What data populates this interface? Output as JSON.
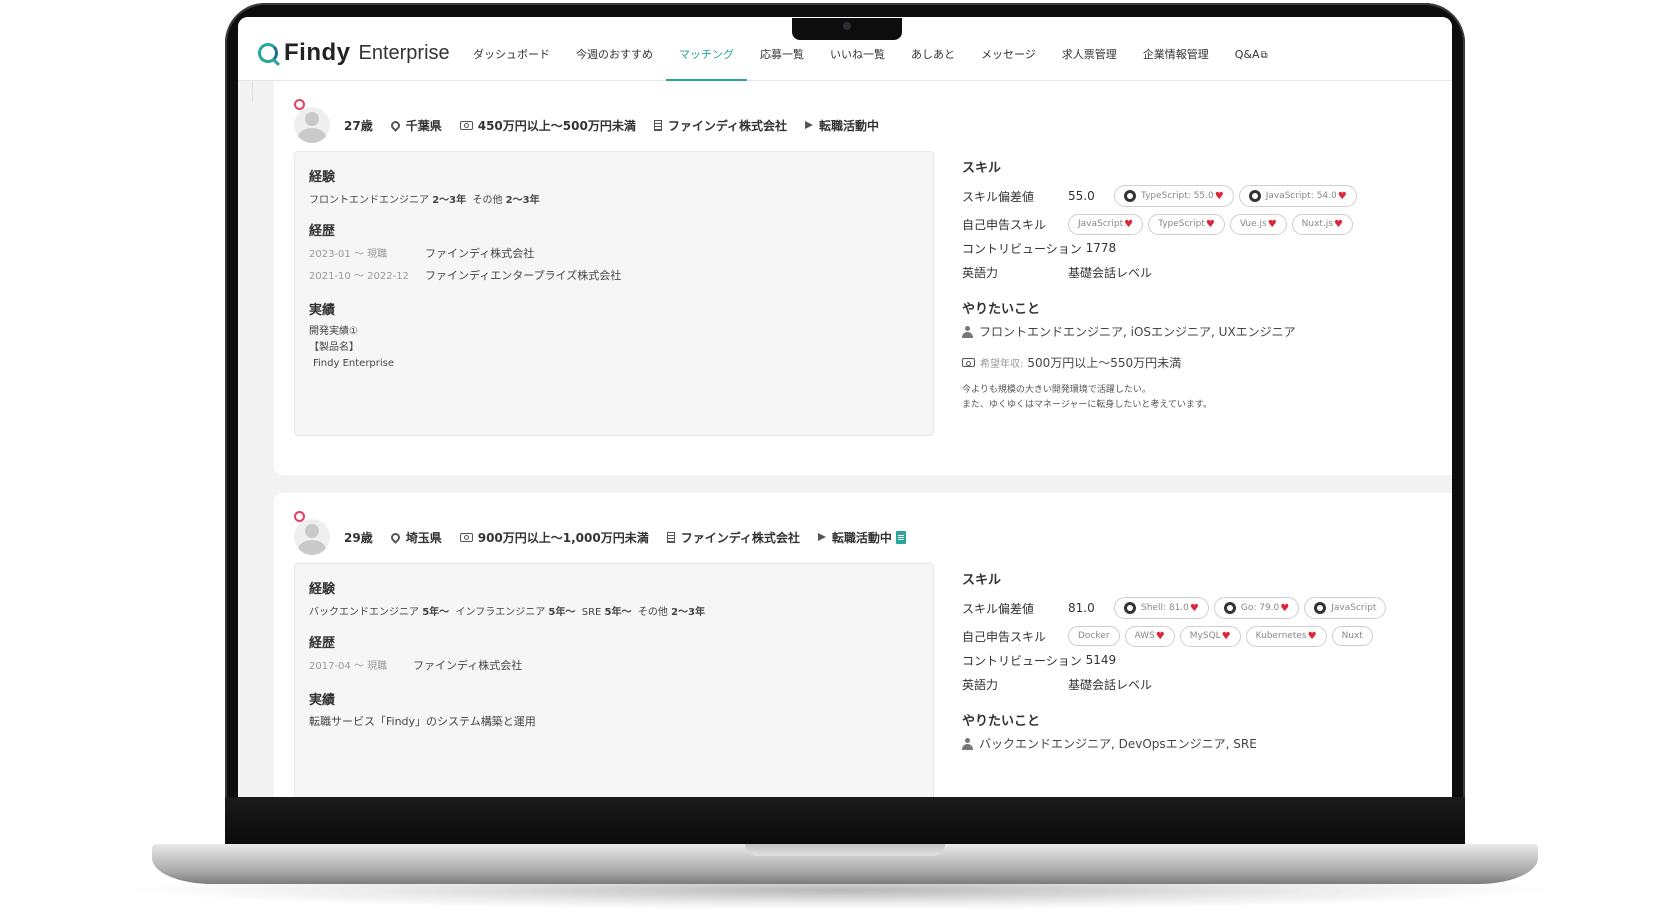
{
  "app": {
    "logo_findy": "Findy",
    "logo_enterprise": "Enterprise"
  },
  "nav": {
    "items": [
      {
        "label": "ダッシュボード"
      },
      {
        "label": "今週のおすすめ"
      },
      {
        "label": "マッチング"
      },
      {
        "label": "応募一覧"
      },
      {
        "label": "いいね一覧"
      },
      {
        "label": "あしあと"
      },
      {
        "label": "メッセージ"
      },
      {
        "label": "求人票管理"
      },
      {
        "label": "企業情報管理"
      },
      {
        "label": "Q&A"
      }
    ],
    "active": "マッチング",
    "external_icon": "⧉"
  },
  "colors": {
    "accent": "#27a79a",
    "heart": "#e0243a",
    "badge": "#e5405e"
  },
  "candidates": [
    {
      "age": "27歳",
      "location": "千葉県",
      "salary": "450万円以上〜500万円未満",
      "company": "ファインディ株式会社",
      "status": "転職活動中",
      "labels": {
        "experience": "経験",
        "career": "経歴",
        "achievements": "実績",
        "skills": "スキル",
        "skill_score": "スキル偏差値",
        "self_skills": "自己申告スキル",
        "contribution": "コントリビューション",
        "english": "英語力",
        "wants": "やりたいこと",
        "desired_salary": "希望年収:"
      },
      "experience": [
        {
          "role": "フロントエンドエンジニア",
          "years": "2〜3年"
        },
        {
          "role": "その他",
          "years": "2〜3年"
        }
      ],
      "career": [
        {
          "period": "2023-01 〜 現職",
          "company": "ファインディ株式会社"
        },
        {
          "period": "2021-10 〜 2022-12",
          "company": "ファインディエンタープライズ株式会社"
        }
      ],
      "achievements": [
        "開発実績①",
        "【製品名】",
        " Findy Enterprise"
      ],
      "skill_score": "55.0",
      "github_skills": [
        "TypeScript: 55.0",
        "JavaScript: 54.0"
      ],
      "self_skills": [
        "JavaScript",
        "TypeScript",
        "Vue.js",
        "Nuxt.js"
      ],
      "contribution": "1778",
      "english": "基礎会話レベル",
      "wants": "フロントエンドエンジニア, iOSエンジニア, UXエンジニア",
      "desired_salary": "500万円以上〜550万円未満",
      "free_text": [
        "今よりも規模の大きい開発環境で活躍したい。",
        "また、ゆくゆくはマネージャーに転身したいと考えています。"
      ]
    },
    {
      "age": "29歳",
      "location": "埼玉県",
      "salary": "900万円以上〜1,000万円未満",
      "company": "ファインディ株式会社",
      "status": "転職活動中",
      "labels": {
        "experience": "経験",
        "career": "経歴",
        "achievements": "実績",
        "skills": "スキル",
        "skill_score": "スキル偏差値",
        "self_skills": "自己申告スキル",
        "contribution": "コントリビューション",
        "english": "英語力",
        "wants": "やりたいこと"
      },
      "experience": [
        {
          "role": "バックエンドエンジニア",
          "years": "5年〜"
        },
        {
          "role": "インフラエンジニア",
          "years": "5年〜"
        },
        {
          "role": "SRE",
          "years": "5年〜"
        },
        {
          "role": "その他",
          "years": "2〜3年"
        }
      ],
      "career": [
        {
          "period": "2017-04 〜 現職",
          "company": "ファインディ株式会社"
        }
      ],
      "achievements": [
        "転職サービス「Findy」のシステム構築と運用"
      ],
      "skill_score": "81.0",
      "github_skills": [
        "Shell: 81.0",
        "Go: 79.0",
        "JavaScript"
      ],
      "self_skills": [
        "Docker",
        "AWS",
        "MySQL",
        "Kubernetes",
        "Nuxt"
      ],
      "contribution": "5149",
      "english": "基礎会話レベル",
      "wants": "バックエンドエンジニア, DevOpsエンジニア, SRE"
    }
  ]
}
